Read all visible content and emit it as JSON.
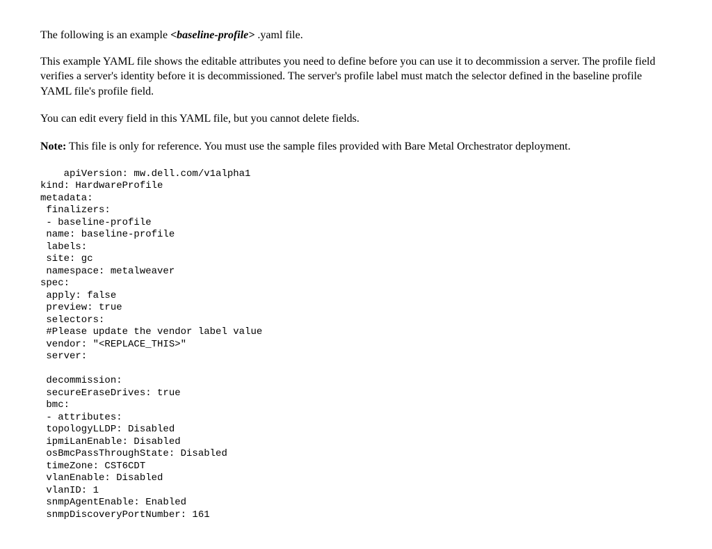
{
  "para1_pre": "The following is an example ",
  "para1_em": "<baseline-profile>",
  "para1_post": " .yaml file.",
  "para2": "This example YAML file shows the editable attributes you need to define before you can use it to decommission a server. The profile field verifies a server's identity before it is decommissioned. The server's profile label must match the selector defined in the baseline profile YAML file's profile field.",
  "para3": "You can edit every field in this YAML file, but you cannot delete fields.",
  "note_label": "Note:",
  "note_text": " This file is only for reference. You must use the sample files provided with Bare Metal Orchestrator deployment.",
  "code": "    apiVersion: mw.dell.com/v1alpha1\nkind: HardwareProfile\nmetadata:\n finalizers:\n - baseline-profile\n name: baseline-profile\n labels:\n site: gc\n namespace: metalweaver\nspec:\n apply: false\n preview: true\n selectors:\n #Please update the vendor label value\n vendor: \"<REPLACE_THIS>\"\n server:\n\n decommission:\n secureEraseDrives: true\n bmc:\n - attributes:\n topologyLLDP: Disabled\n ipmiLanEnable: Disabled\n osBmcPassThroughState: Disabled\n timeZone: CST6CDT\n vlanEnable: Disabled\n vlanID: 1\n snmpAgentEnable: Enabled\n snmpDiscoveryPortNumber: 161"
}
